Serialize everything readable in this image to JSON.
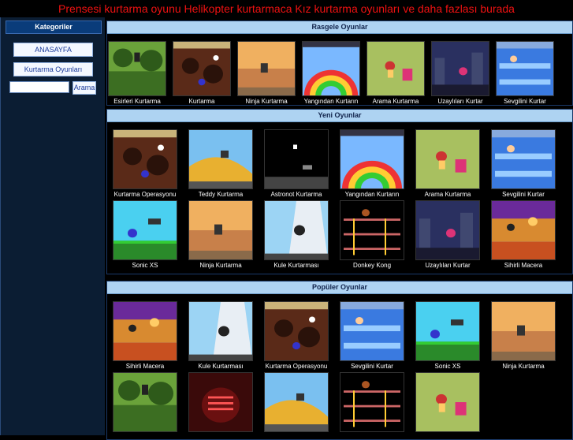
{
  "top_title": "Prensesi kurtarma oyunu Helikopter kurtarmaca Kız kurtarma oyunları ve daha fazlası burada",
  "sidebar": {
    "heading": "Kategoriler",
    "home_label": "ANASAYFA",
    "category_label": "Kurtarma Oyunları",
    "search_value": "",
    "search_button": "Arama"
  },
  "random": {
    "heading": "Rasgele Oyunlar",
    "items": [
      {
        "title": "Esirleri Kurtarma",
        "theme": "jungle"
      },
      {
        "title": "Kurtarma",
        "theme": "cave"
      },
      {
        "title": "Ninja Kurtarma",
        "theme": "desert"
      },
      {
        "title": "Yangından Kurtarın",
        "theme": "rainbow"
      },
      {
        "title": "Arama Kurtarma",
        "theme": "meadow"
      },
      {
        "title": "Uzaylıları Kurtar",
        "theme": "night"
      },
      {
        "title": "Sevgilini Kurtar",
        "theme": "blue"
      }
    ]
  },
  "new": {
    "heading": "Yeni Oyunlar",
    "items": [
      {
        "title": "Kurtarma Operasyonu",
        "theme": "cave"
      },
      {
        "title": "Teddy Kurtarma",
        "theme": "dune"
      },
      {
        "title": "Astronot Kurtarma",
        "theme": "space"
      },
      {
        "title": "Yangından Kurtarın",
        "theme": "rainbow"
      },
      {
        "title": "Arama Kurtarma",
        "theme": "meadow"
      },
      {
        "title": "Sevgilini Kurtar",
        "theme": "blue"
      },
      {
        "title": "Sonic XS",
        "theme": "sonic"
      },
      {
        "title": "Ninja Kurtarma",
        "theme": "desert"
      },
      {
        "title": "Kule Kurtarması",
        "theme": "tower"
      },
      {
        "title": "Donkey Kong",
        "theme": "kong"
      },
      {
        "title": "Uzaylıları Kurtar",
        "theme": "night"
      },
      {
        "title": "Sihirli Macera",
        "theme": "magic"
      }
    ]
  },
  "popular": {
    "heading": "Popüler Oyunlar",
    "items": [
      {
        "title": "Sihirli Macera",
        "theme": "magic"
      },
      {
        "title": "Kule Kurtarması",
        "theme": "tower"
      },
      {
        "title": "Kurtarma Operasyonu",
        "theme": "cave"
      },
      {
        "title": "Sevgilini Kurtar",
        "theme": "blue"
      },
      {
        "title": "Sonic XS",
        "theme": "sonic"
      },
      {
        "title": "Ninja Kurtarma",
        "theme": "desert"
      },
      {
        "title": "",
        "theme": "jungle"
      },
      {
        "title": "",
        "theme": "redtext"
      },
      {
        "title": "",
        "theme": "dune"
      },
      {
        "title": "",
        "theme": "kong"
      },
      {
        "title": "",
        "theme": "meadow"
      }
    ]
  },
  "colors": {
    "title_red": "#ee1111",
    "panel_header": "#aed3f2",
    "sidebar_bg": "#0b1d33"
  }
}
